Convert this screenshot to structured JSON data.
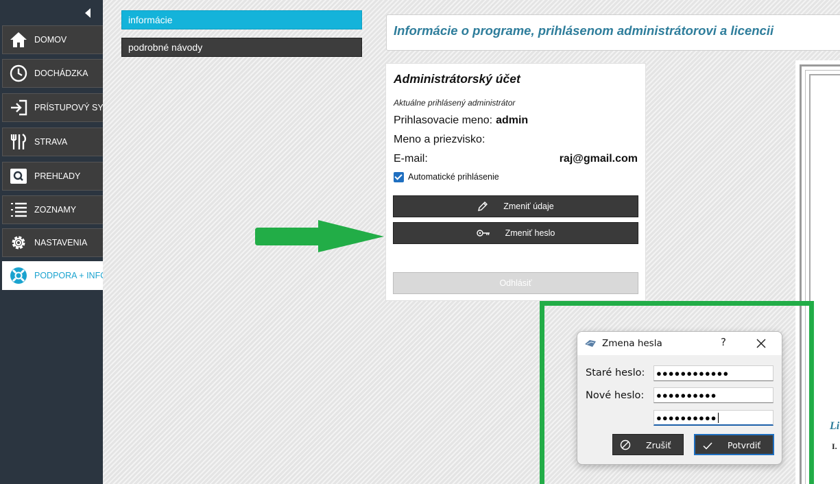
{
  "sidebar": {
    "items": [
      {
        "label": "DOMOV",
        "icon": "home-icon"
      },
      {
        "label": "DOCHÁDZKA",
        "icon": "clock-icon"
      },
      {
        "label": "PRÍSTUPOVÝ SYS",
        "icon": "login-arrow-icon"
      },
      {
        "label": "STRAVA",
        "icon": "cutlery-icon"
      },
      {
        "label": "PREHĽADY",
        "icon": "search-icon"
      },
      {
        "label": "ZOZNAMY",
        "icon": "list-icon"
      },
      {
        "label": "NASTAVENIA",
        "icon": "gear-icon"
      },
      {
        "label": "PODPORA + INFO",
        "icon": "lifebuoy-icon",
        "active": true
      }
    ]
  },
  "submenu": {
    "info": "informácie",
    "guides": "podrobné návody"
  },
  "header": {
    "title": "Informácie o programe, prihlásenom administrátorovi a licencii"
  },
  "account": {
    "title": "Administrátorský účet",
    "subtitle": "Aktuálne prihlásený administrátor",
    "login_label": "Prihlasovacie meno:",
    "login_value": "admin",
    "name_label": "Meno a priezvisko:",
    "email_label": "E-mail:",
    "email_value": "raj@gmail.com",
    "auto_login_label": "Automatické prihlásenie",
    "auto_login_checked": true,
    "edit_button": "Zmeniť údaje",
    "change_password_button": "Zmeniť heslo",
    "logout_button": "Odhlásiť"
  },
  "license": {
    "heading": "Li",
    "section_number": "I."
  },
  "dialog": {
    "title": "Zmena hesla",
    "help": "?",
    "old_password_label": "Staré heslo:",
    "old_password_value": "●●●●●●●●●●●●",
    "new_password_label": "Nové heslo:",
    "new_password_value": "●●●●●●●●●●",
    "confirm_password_value": "●●●●●●●●●●",
    "cancel_button": "Zrušiť",
    "confirm_button": "Potvrdiť"
  },
  "colors": {
    "sidebar_bg": "#2b3540",
    "accent": "#14b3da",
    "title_text": "#2e7d9b",
    "highlight": "#22ad47"
  }
}
